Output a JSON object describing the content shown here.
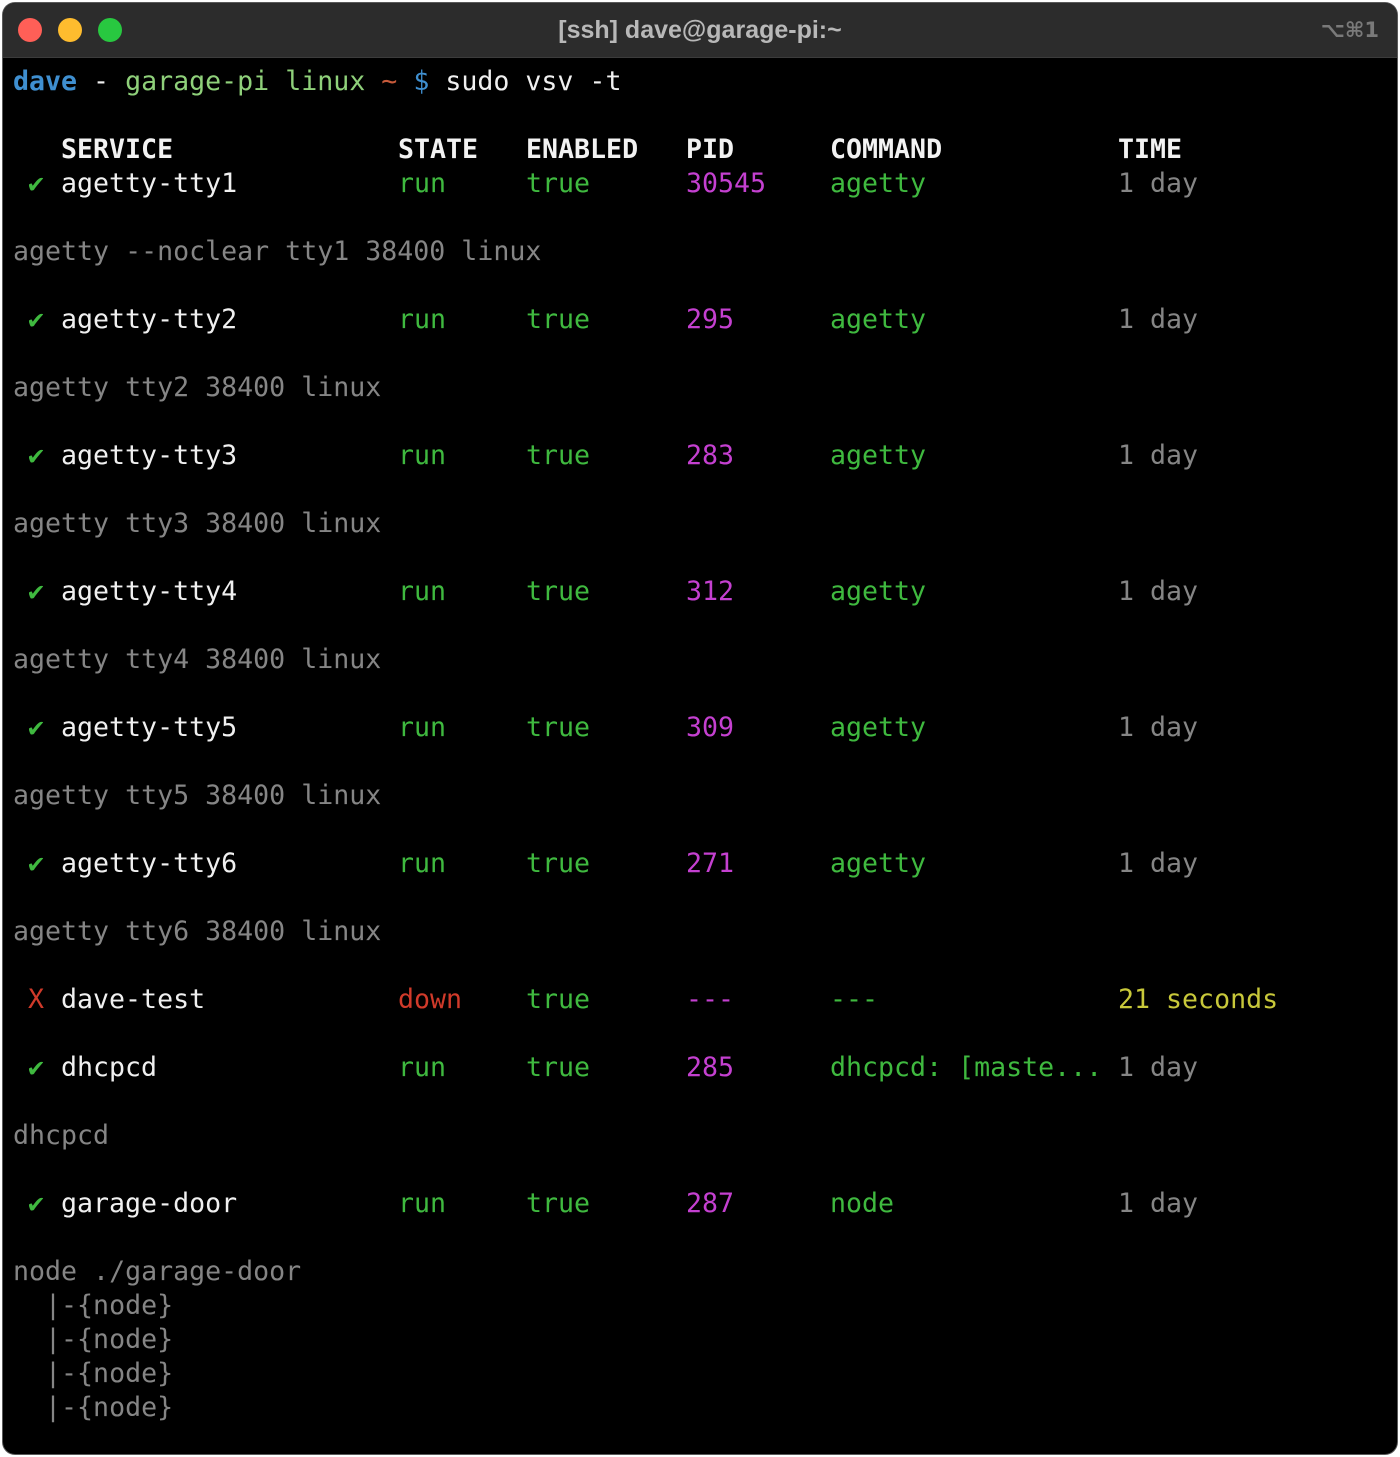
{
  "window": {
    "title": "[ssh] dave@garage-pi:~",
    "shortcut": "⌥⌘1"
  },
  "prompt": {
    "user": "dave",
    "sep": " - ",
    "host": "garage-pi linux",
    "tilde": " ~ ",
    "dollar": "$",
    "command": " sudo vsv -t"
  },
  "table": {
    "headers": {
      "service": "SERVICE",
      "state": "STATE",
      "enabled": "ENABLED",
      "pid": "PID",
      "command": "COMMAND",
      "time": "TIME"
    },
    "rows": [
      {
        "mark": "✔",
        "service": "agetty-tty1",
        "state": "run",
        "enabled": "true",
        "pid": "30545",
        "command": "agetty",
        "time": "1 day",
        "tree": [
          "agetty --noclear tty1 38400 linux"
        ]
      },
      {
        "mark": "✔",
        "service": "agetty-tty2",
        "state": "run",
        "enabled": "true",
        "pid": "295",
        "command": "agetty",
        "time": "1 day",
        "tree": [
          "agetty tty2 38400 linux"
        ]
      },
      {
        "mark": "✔",
        "service": "agetty-tty3",
        "state": "run",
        "enabled": "true",
        "pid": "283",
        "command": "agetty",
        "time": "1 day",
        "tree": [
          "agetty tty3 38400 linux"
        ]
      },
      {
        "mark": "✔",
        "service": "agetty-tty4",
        "state": "run",
        "enabled": "true",
        "pid": "312",
        "command": "agetty",
        "time": "1 day",
        "tree": [
          "agetty tty4 38400 linux"
        ]
      },
      {
        "mark": "✔",
        "service": "agetty-tty5",
        "state": "run",
        "enabled": "true",
        "pid": "309",
        "command": "agetty",
        "time": "1 day",
        "tree": [
          "agetty tty5 38400 linux"
        ]
      },
      {
        "mark": "✔",
        "service": "agetty-tty6",
        "state": "run",
        "enabled": "true",
        "pid": "271",
        "command": "agetty",
        "time": "1 day",
        "tree": [
          "agetty tty6 38400 linux"
        ]
      },
      {
        "mark": "X",
        "service": "dave-test",
        "state": "down",
        "enabled": "true",
        "pid": "---",
        "command": "---",
        "time": "21 seconds",
        "tree": []
      },
      {
        "mark": "✔",
        "service": "dhcpcd",
        "state": "run",
        "enabled": "true",
        "pid": "285",
        "command": "dhcpcd: [maste...",
        "time": "1 day",
        "tree": [
          "dhcpcd"
        ]
      },
      {
        "mark": "✔",
        "service": "garage-door",
        "state": "run",
        "enabled": "true",
        "pid": "287",
        "command": "node",
        "time": "1 day",
        "tree": [
          "node ./garage-door",
          "  |-{node}",
          "  |-{node}",
          "  |-{node}",
          "  |-{node}"
        ]
      }
    ]
  },
  "colors": {
    "ok": "#3fb93f",
    "down": "#d03a2a",
    "pid": "#c440d0",
    "time": "#858585",
    "time_recent": "#c8c83a",
    "tree": "#858585"
  }
}
